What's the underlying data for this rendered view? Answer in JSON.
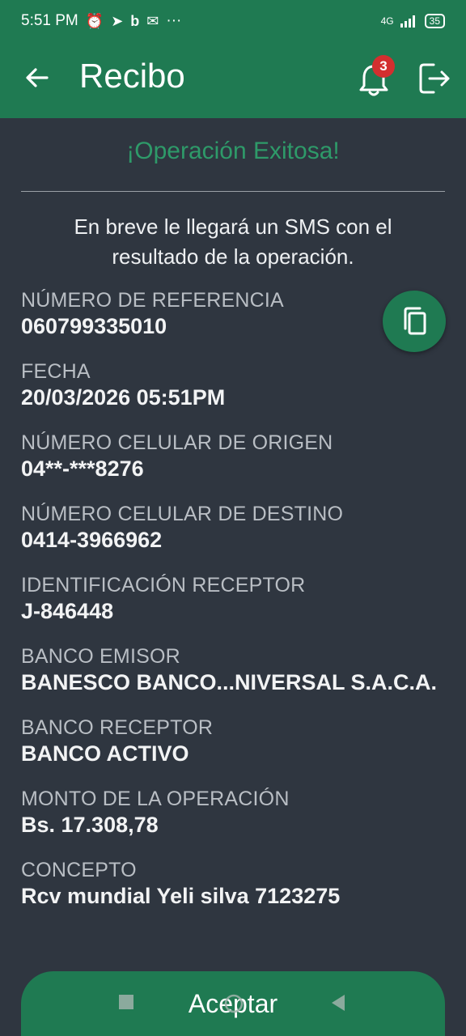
{
  "status_bar": {
    "time": "5:51 PM",
    "network": "4G",
    "battery": "35",
    "more": "···",
    "icons": [
      "alarm-icon",
      "telegram-icon",
      "b-icon",
      "mail-icon"
    ]
  },
  "appbar": {
    "title": "Recibo",
    "notifications_count": "3"
  },
  "receipt": {
    "status": "¡Operación Exitosa!",
    "message": "En breve le llegará un SMS con el resultado de la operación."
  },
  "fields": [
    {
      "label": "NÚMERO DE REFERENCIA",
      "value": "060799335010"
    },
    {
      "label": "FECHA",
      "value": "20/03/2026 05:51PM"
    },
    {
      "label": "NÚMERO CELULAR DE ORIGEN",
      "value": "04**-***8276"
    },
    {
      "label": "NÚMERO CELULAR DE DESTINO",
      "value": "0414-3966962"
    },
    {
      "label": "IDENTIFICACIÓN RECEPTOR",
      "value": "J-846448"
    },
    {
      "label": "BANCO EMISOR",
      "value": "BANESCO BANCO...NIVERSAL S.A.C.A."
    },
    {
      "label": "BANCO RECEPTOR",
      "value": "BANCO ACTIVO"
    },
    {
      "label": "MONTO DE LA OPERACIÓN",
      "value": "Bs. 17.308,78"
    },
    {
      "label": "CONCEPTO",
      "value": "Rcv mundial Yeli silva 7123275"
    }
  ],
  "actions": {
    "accept_label": "Aceptar"
  },
  "colors": {
    "primary": "#1f7a52",
    "success_text": "#2e9a69",
    "background": "#2f3640",
    "badge": "#d32f2f"
  }
}
